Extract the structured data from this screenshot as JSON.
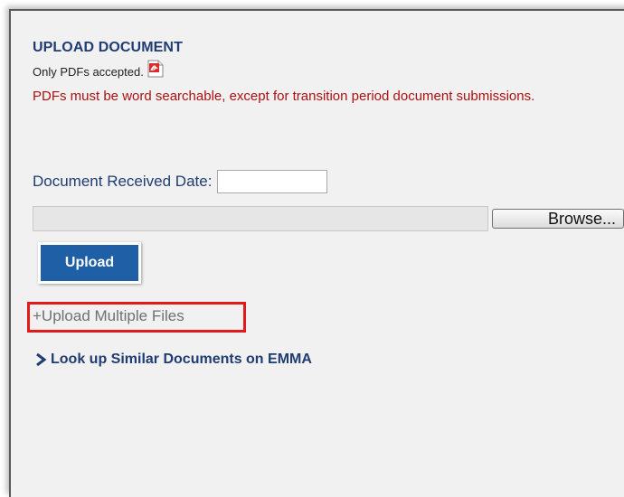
{
  "upload": {
    "title": "UPLOAD DOCUMENT",
    "pdf_note": "Only PDFs accepted.",
    "pdf_icon": "pdf-file-icon",
    "warning": "PDFs must be word searchable, except for transition period document submissions.",
    "date_label": "Document Received Date:",
    "date_value": "",
    "browse_label": "Browse...",
    "upload_label": "Upload",
    "multiple_files_label": "+Upload Multiple Files",
    "lookup_label": "Look up Similar Documents on EMMA",
    "lookup_icon": "chevron-right-icon"
  },
  "colors": {
    "title": "#1f3d73",
    "warning": "#b01010",
    "upload_button": "#1f5fa6",
    "highlight_box": "#e11b1b",
    "panel_background": "#f1f1f1"
  }
}
